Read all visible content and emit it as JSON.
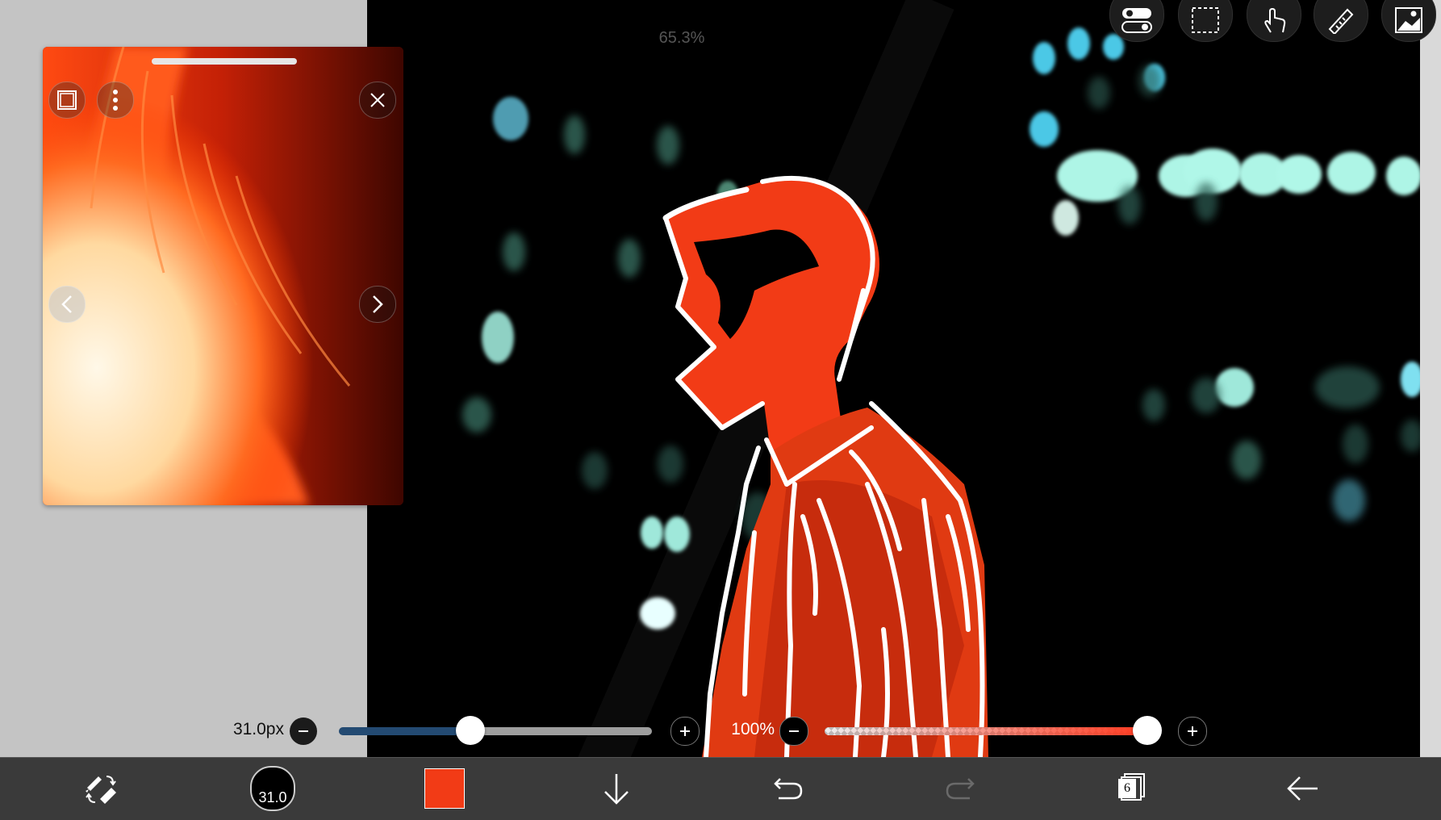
{
  "canvas": {
    "zoom_label": "65.3%",
    "background": "#000000",
    "figure_color": "#f23b16",
    "line_color": "#ffffff"
  },
  "top_toolbar": {
    "icons": [
      "toggle-settings-icon",
      "selection-icon",
      "hand-tool-icon",
      "ruler-icon",
      "image-import-icon"
    ]
  },
  "reference_panel": {
    "icons": [
      "square-icon",
      "more-icon",
      "close-icon",
      "chevron-left-icon",
      "chevron-right-icon"
    ]
  },
  "brush_size": {
    "label": "31.0px",
    "value": 31.0,
    "fraction": 0.42,
    "track_color": "#234a72"
  },
  "opacity": {
    "label": "100%",
    "value": 100,
    "fraction": 1.0,
    "accent": "#ff3a20"
  },
  "bottom_toolbar": {
    "brush_size_badge": "31.0",
    "current_color": "#f23b16",
    "layer_count": "6",
    "icons": [
      "brush-eraser-swap-icon",
      "brush-size-icon",
      "color-swatch",
      "download-icon",
      "undo-icon",
      "redo-icon",
      "layers-icon",
      "back-arrow-icon"
    ]
  }
}
